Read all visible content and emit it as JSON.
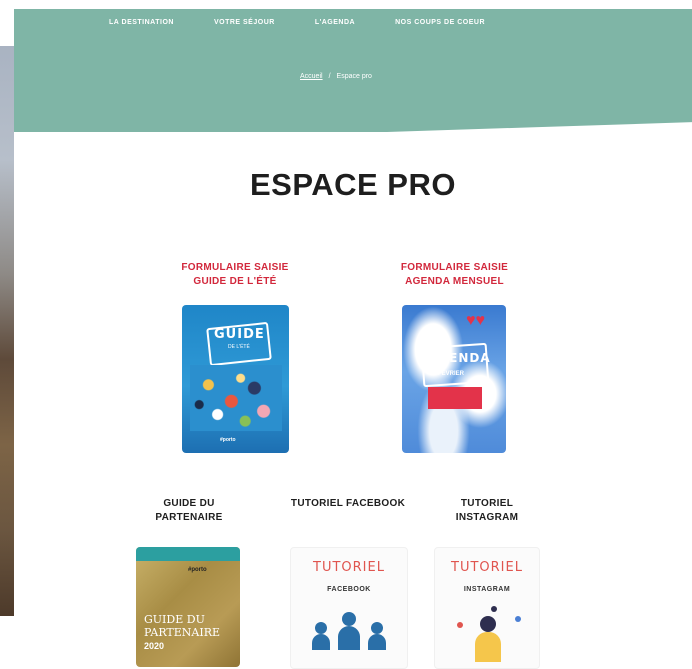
{
  "nav": {
    "items": [
      "LA DESTINATION",
      "VOTRE SÉJOUR",
      "L'AGENDA",
      "NOS COUPS DE COEUR"
    ]
  },
  "breadcrumb": {
    "home": "Accueil",
    "separator": "/",
    "current": "Espace pro"
  },
  "page": {
    "title": "ESPACE PRO"
  },
  "cards": {
    "guide_ete": {
      "title": "FORMULAIRE SAISIE\nGUIDE DE L'ÉTÉ",
      "cover_big": "GUIDE",
      "cover_small": "DE L'ÉTÉ",
      "cover_foot": "#porto"
    },
    "agenda": {
      "title": "FORMULAIRE SAISIE\nAGENDA MENSUEL",
      "cover_big": "AGENDA",
      "cover_month": "FÉVRIER"
    },
    "partner": {
      "title": "GUIDE DU\nPARTENAIRE",
      "cover_text": "GUIDE DU\nPARTENAIRE",
      "cover_year": "2020",
      "cover_logo": "#porto"
    },
    "facebook": {
      "title": "TUTORIEL FACEBOOK",
      "cover_title": "TUTORIEL",
      "cover_sub": "FACEBOOK"
    },
    "instagram": {
      "title": "TUTORIEL\nINSTAGRAM",
      "cover_title": "TUTORIEL",
      "cover_sub": "INSTAGRAM"
    }
  },
  "colors": {
    "header": "#7fb5a6",
    "card_title_red": "#d2283c",
    "tuto_accent": "#e0554f"
  }
}
